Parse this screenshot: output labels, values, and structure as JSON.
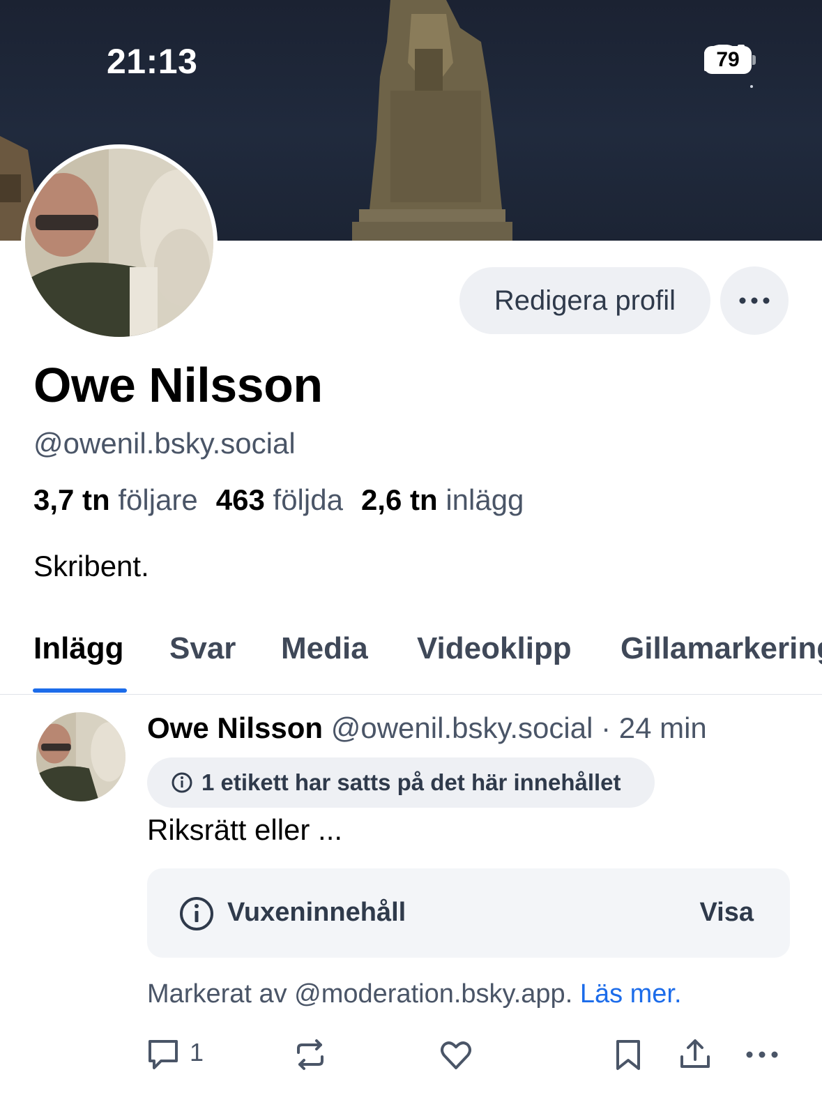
{
  "status_bar": {
    "time": "21:13",
    "battery": "79"
  },
  "profile": {
    "edit_button": "Redigera profil",
    "name": "Owe Nilsson",
    "handle": "@owenil.bsky.social",
    "stats": [
      {
        "value": "3,7 tn",
        "label": "följare"
      },
      {
        "value": "463",
        "label": "följda"
      },
      {
        "value": "2,6 tn",
        "label": "inlägg"
      }
    ],
    "bio": "Skribent."
  },
  "tabs": [
    "Inlägg",
    "Svar",
    "Media",
    "Videoklipp",
    "Gillamarkeringar"
  ],
  "post": {
    "author": "Owe Nilsson",
    "handle": "@owenil.bsky.social",
    "time": "· 24 min",
    "label_notice": "1 etikett har satts på det här innehållet",
    "text": "Riksrätt eller ...",
    "adult_label": "Vuxeninnehåll",
    "show_label": "Visa",
    "marked_by": "Markerat av @moderation.bsky.app.",
    "read_more": "Läs mer.",
    "reply_count": "1"
  },
  "colors": {
    "accent": "#1c6cea",
    "pill_bg": "#eef0f4",
    "muted_text": "#4a5567"
  }
}
